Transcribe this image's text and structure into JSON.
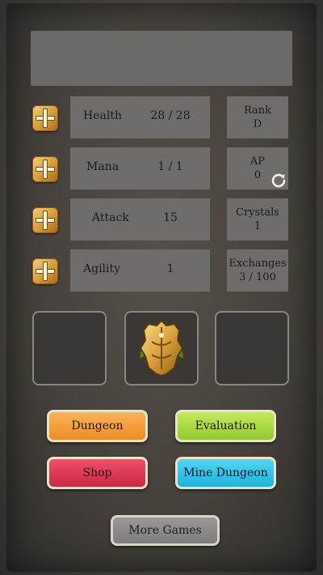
{
  "stats": [
    {
      "label": "Health",
      "value": "28 / 28"
    },
    {
      "label": "Mana",
      "value": "1 / 1"
    },
    {
      "label": "Attack",
      "value": "15"
    },
    {
      "label": "Agility",
      "value": "1"
    }
  ],
  "side": {
    "rank": {
      "label": "Rank",
      "value": "D"
    },
    "ap": {
      "label": "AP",
      "value": "0"
    },
    "crystals": {
      "label": "Crystals",
      "value": "1"
    },
    "exchanges": {
      "label": "Exchanges",
      "value": "3 / 100"
    }
  },
  "equipment": {
    "center_item_icon": "golden-armor-icon"
  },
  "buttons": {
    "dungeon": "Dungeon",
    "evaluation": "Evaluation",
    "shop": "Shop",
    "mine_dungeon": "Mine Dungeon",
    "more_games": "More Games"
  },
  "colors": {
    "dungeon": "#f59a30",
    "evaluation": "#a8d844",
    "shop": "#dd3652",
    "mine_dungeon": "#35c3ea",
    "more_games": "#8a8888"
  }
}
